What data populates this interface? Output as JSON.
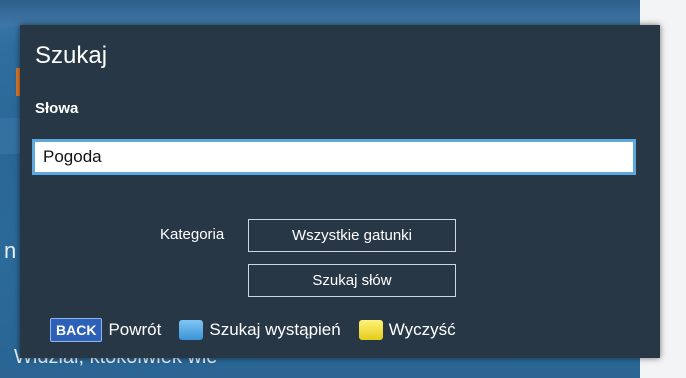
{
  "background": {
    "bottom_text": "Widział, ktokolwiek wie",
    "side_letter": "n"
  },
  "dialog": {
    "title": "Szukaj",
    "words_label": "Słowa",
    "search_value": "Pogoda",
    "category_label": "Kategoria",
    "category_button": "Wszystkie gatunki",
    "search_words_button": "Szukaj słów"
  },
  "hints": {
    "back_key": "BACK",
    "back_label": "Powrót",
    "blue_label": "Szukaj wystąpień",
    "yellow_label": "Wyczyść"
  },
  "colors": {
    "dialog_bg": "#283746",
    "input_border": "#5fa8df",
    "blue_key": "#3a92d6",
    "yellow_key": "#e3cb1a"
  }
}
